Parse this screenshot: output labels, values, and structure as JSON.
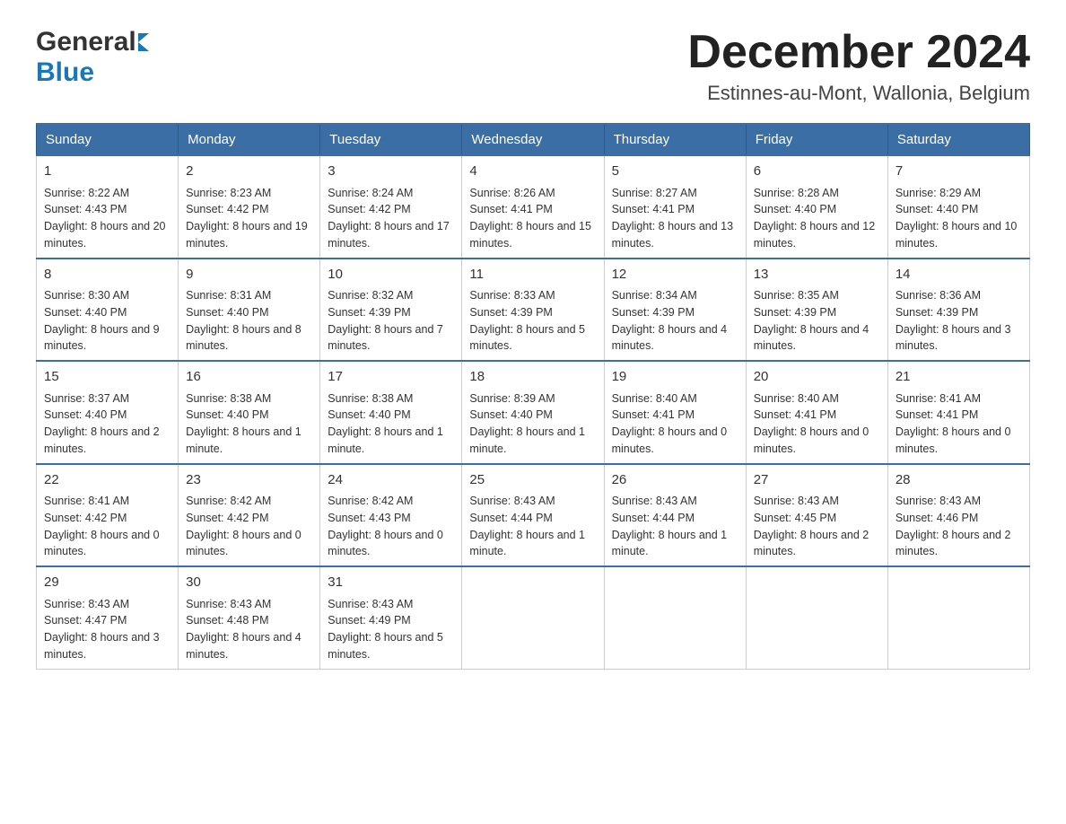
{
  "header": {
    "logo_general": "General",
    "logo_blue": "Blue",
    "main_title": "December 2024",
    "subtitle": "Estinnes-au-Mont, Wallonia, Belgium"
  },
  "calendar": {
    "days_of_week": [
      "Sunday",
      "Monday",
      "Tuesday",
      "Wednesday",
      "Thursday",
      "Friday",
      "Saturday"
    ],
    "weeks": [
      [
        {
          "day": "1",
          "sunrise": "8:22 AM",
          "sunset": "4:43 PM",
          "daylight": "8 hours and 20 minutes."
        },
        {
          "day": "2",
          "sunrise": "8:23 AM",
          "sunset": "4:42 PM",
          "daylight": "8 hours and 19 minutes."
        },
        {
          "day": "3",
          "sunrise": "8:24 AM",
          "sunset": "4:42 PM",
          "daylight": "8 hours and 17 minutes."
        },
        {
          "day": "4",
          "sunrise": "8:26 AM",
          "sunset": "4:41 PM",
          "daylight": "8 hours and 15 minutes."
        },
        {
          "day": "5",
          "sunrise": "8:27 AM",
          "sunset": "4:41 PM",
          "daylight": "8 hours and 13 minutes."
        },
        {
          "day": "6",
          "sunrise": "8:28 AM",
          "sunset": "4:40 PM",
          "daylight": "8 hours and 12 minutes."
        },
        {
          "day": "7",
          "sunrise": "8:29 AM",
          "sunset": "4:40 PM",
          "daylight": "8 hours and 10 minutes."
        }
      ],
      [
        {
          "day": "8",
          "sunrise": "8:30 AM",
          "sunset": "4:40 PM",
          "daylight": "8 hours and 9 minutes."
        },
        {
          "day": "9",
          "sunrise": "8:31 AM",
          "sunset": "4:40 PM",
          "daylight": "8 hours and 8 minutes."
        },
        {
          "day": "10",
          "sunrise": "8:32 AM",
          "sunset": "4:39 PM",
          "daylight": "8 hours and 7 minutes."
        },
        {
          "day": "11",
          "sunrise": "8:33 AM",
          "sunset": "4:39 PM",
          "daylight": "8 hours and 5 minutes."
        },
        {
          "day": "12",
          "sunrise": "8:34 AM",
          "sunset": "4:39 PM",
          "daylight": "8 hours and 4 minutes."
        },
        {
          "day": "13",
          "sunrise": "8:35 AM",
          "sunset": "4:39 PM",
          "daylight": "8 hours and 4 minutes."
        },
        {
          "day": "14",
          "sunrise": "8:36 AM",
          "sunset": "4:39 PM",
          "daylight": "8 hours and 3 minutes."
        }
      ],
      [
        {
          "day": "15",
          "sunrise": "8:37 AM",
          "sunset": "4:40 PM",
          "daylight": "8 hours and 2 minutes."
        },
        {
          "day": "16",
          "sunrise": "8:38 AM",
          "sunset": "4:40 PM",
          "daylight": "8 hours and 1 minute."
        },
        {
          "day": "17",
          "sunrise": "8:38 AM",
          "sunset": "4:40 PM",
          "daylight": "8 hours and 1 minute."
        },
        {
          "day": "18",
          "sunrise": "8:39 AM",
          "sunset": "4:40 PM",
          "daylight": "8 hours and 1 minute."
        },
        {
          "day": "19",
          "sunrise": "8:40 AM",
          "sunset": "4:41 PM",
          "daylight": "8 hours and 0 minutes."
        },
        {
          "day": "20",
          "sunrise": "8:40 AM",
          "sunset": "4:41 PM",
          "daylight": "8 hours and 0 minutes."
        },
        {
          "day": "21",
          "sunrise": "8:41 AM",
          "sunset": "4:41 PM",
          "daylight": "8 hours and 0 minutes."
        }
      ],
      [
        {
          "day": "22",
          "sunrise": "8:41 AM",
          "sunset": "4:42 PM",
          "daylight": "8 hours and 0 minutes."
        },
        {
          "day": "23",
          "sunrise": "8:42 AM",
          "sunset": "4:42 PM",
          "daylight": "8 hours and 0 minutes."
        },
        {
          "day": "24",
          "sunrise": "8:42 AM",
          "sunset": "4:43 PM",
          "daylight": "8 hours and 0 minutes."
        },
        {
          "day": "25",
          "sunrise": "8:43 AM",
          "sunset": "4:44 PM",
          "daylight": "8 hours and 1 minute."
        },
        {
          "day": "26",
          "sunrise": "8:43 AM",
          "sunset": "4:44 PM",
          "daylight": "8 hours and 1 minute."
        },
        {
          "day": "27",
          "sunrise": "8:43 AM",
          "sunset": "4:45 PM",
          "daylight": "8 hours and 2 minutes."
        },
        {
          "day": "28",
          "sunrise": "8:43 AM",
          "sunset": "4:46 PM",
          "daylight": "8 hours and 2 minutes."
        }
      ],
      [
        {
          "day": "29",
          "sunrise": "8:43 AM",
          "sunset": "4:47 PM",
          "daylight": "8 hours and 3 minutes."
        },
        {
          "day": "30",
          "sunrise": "8:43 AM",
          "sunset": "4:48 PM",
          "daylight": "8 hours and 4 minutes."
        },
        {
          "day": "31",
          "sunrise": "8:43 AM",
          "sunset": "4:49 PM",
          "daylight": "8 hours and 5 minutes."
        },
        null,
        null,
        null,
        null
      ]
    ]
  }
}
